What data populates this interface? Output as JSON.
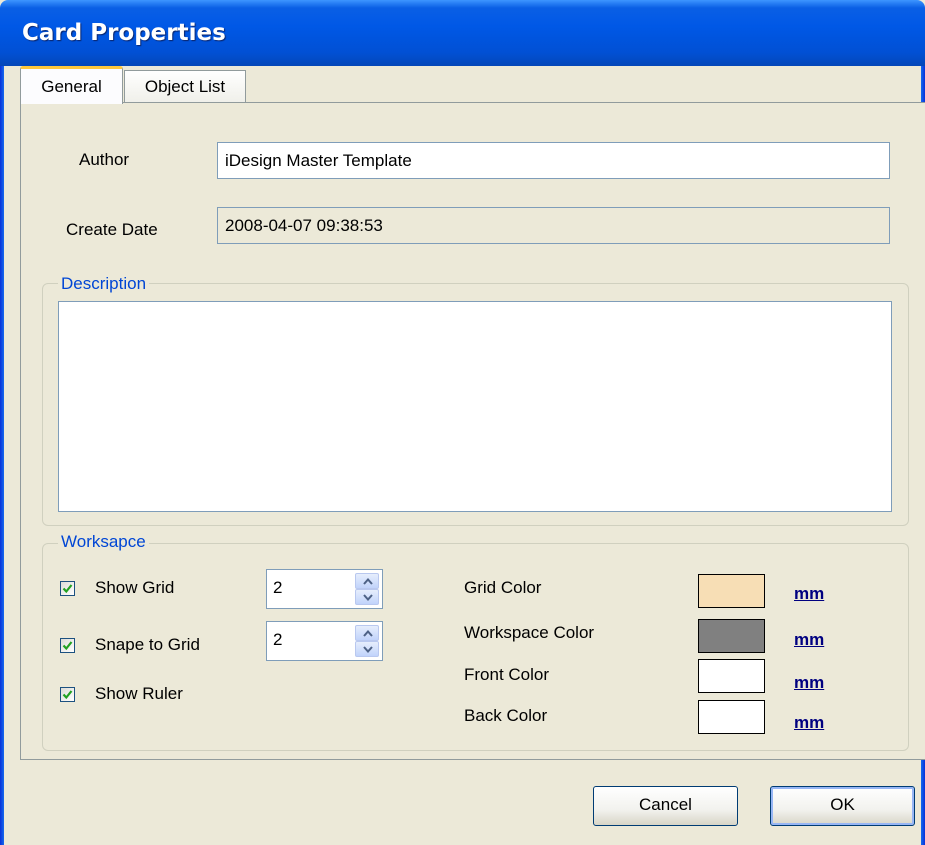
{
  "window": {
    "title": "Card Properties"
  },
  "tabs": [
    {
      "label": "General",
      "active": true
    },
    {
      "label": "Object List",
      "active": false
    }
  ],
  "general": {
    "author_label": "Author",
    "author_value": "iDesign Master Template",
    "create_date_label": "Create Date",
    "create_date_value": "2008-04-07 09:38:53",
    "description_title": "Description",
    "description_value": ""
  },
  "workspace": {
    "title": "Worksapce",
    "show_grid": {
      "label": "Show Grid",
      "checked": true,
      "value": "2"
    },
    "snap_to_grid": {
      "label": "Snape to Grid",
      "checked": true,
      "value": "2"
    },
    "show_ruler": {
      "label": "Show Ruler",
      "checked": true
    },
    "colors": [
      {
        "label": "Grid Color",
        "color": "#f7deb5",
        "link": "mm"
      },
      {
        "label": "Workspace Color",
        "color": "#808080",
        "link": "mm"
      },
      {
        "label": "Front Color",
        "color": "#ffffff",
        "link": "mm"
      },
      {
        "label": "Back Color",
        "color": "#ffffff",
        "link": "mm"
      }
    ]
  },
  "buttons": {
    "cancel": "Cancel",
    "ok": "OK"
  },
  "theme": {
    "titlebar": "#0058e6",
    "dialog_bg": "#ece9d8",
    "group_title": "#0046d5",
    "link": "#000080"
  }
}
